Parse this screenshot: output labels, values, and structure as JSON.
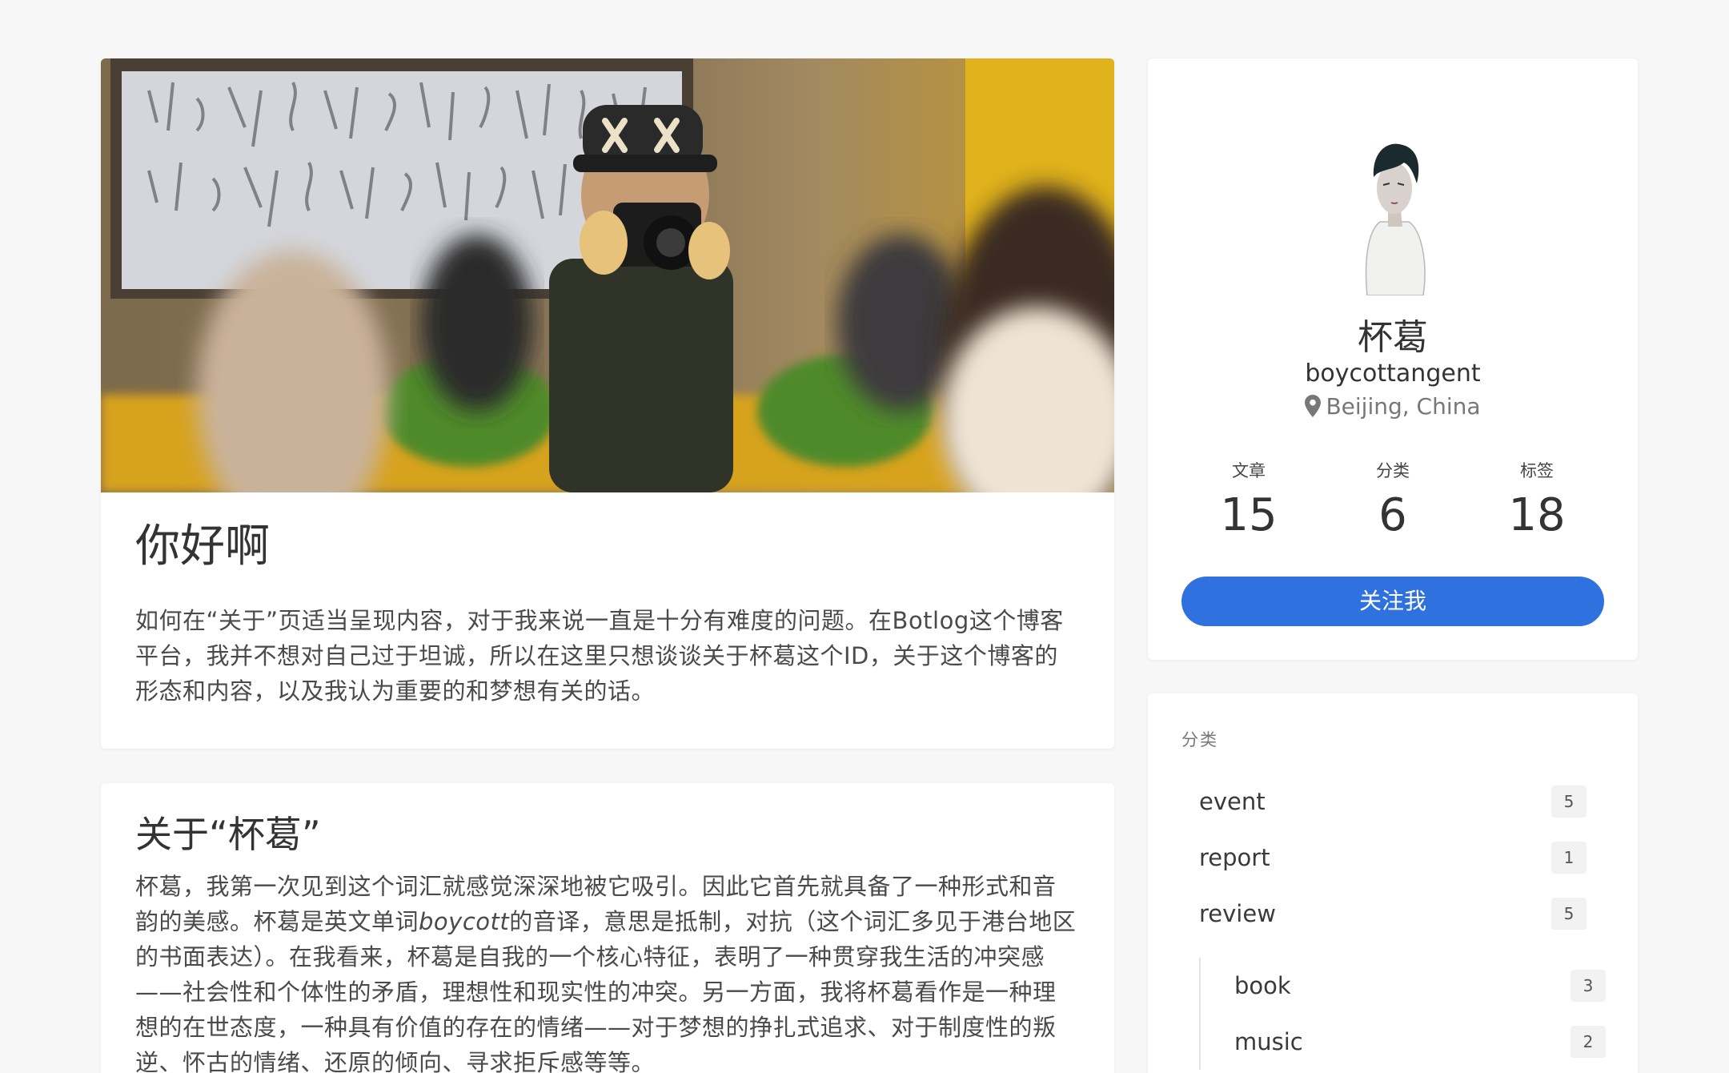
{
  "intro": {
    "title": "你好啊",
    "paragraph": "如何在“关于”页适当呈现内容，对于我来说一直是十分有难度的问题。在Botlog这个博客平台，我并不想对自己过于坦诚，所以在这里只想谈谈关于杯葛这个ID，关于这个博客的形态和内容，以及我认为重要的和梦想有关的话。"
  },
  "about": {
    "title": "关于“杯葛”",
    "para_part1": "杯葛，我第一次见到这个词汇就感觉深深地被它吸引。因此它首先就具备了一种形式和音韵的美感。杯葛是英文单词",
    "para_italic": "boycott",
    "para_part2": "的音译，意思是抵制，对抗（这个词汇多见于港台地区的书面表达）。在我看来，杯葛是自我的一个核心特征，表明了一种贯穿我生活的冲突感——社会性和个体性的矛盾，理想性和现实性的冲突。另一方面，我将杯葛看作是一种理想的在世态度，一种具有价值的存在的情绪——对于梦想的挣扎式追求、对于制度性的叛逆、怀古的情绪、还原的倾向、寻求拒斥感等等。"
  },
  "profile": {
    "name": "杯葛",
    "handle": "boycottangent",
    "location": "Beijing, China",
    "stats": [
      {
        "label": "文章",
        "value": "15"
      },
      {
        "label": "分类",
        "value": "6"
      },
      {
        "label": "标签",
        "value": "18"
      }
    ],
    "follow_label": "关注我",
    "accent_color": "#2f72df"
  },
  "categories": {
    "title": "分类",
    "items": [
      {
        "name": "event",
        "count": "5"
      },
      {
        "name": "report",
        "count": "1"
      },
      {
        "name": "review",
        "count": "5"
      }
    ],
    "sub_items": [
      {
        "name": "book",
        "count": "3"
      },
      {
        "name": "music",
        "count": "2"
      }
    ]
  },
  "icons": {
    "location": "map-pin-icon"
  }
}
